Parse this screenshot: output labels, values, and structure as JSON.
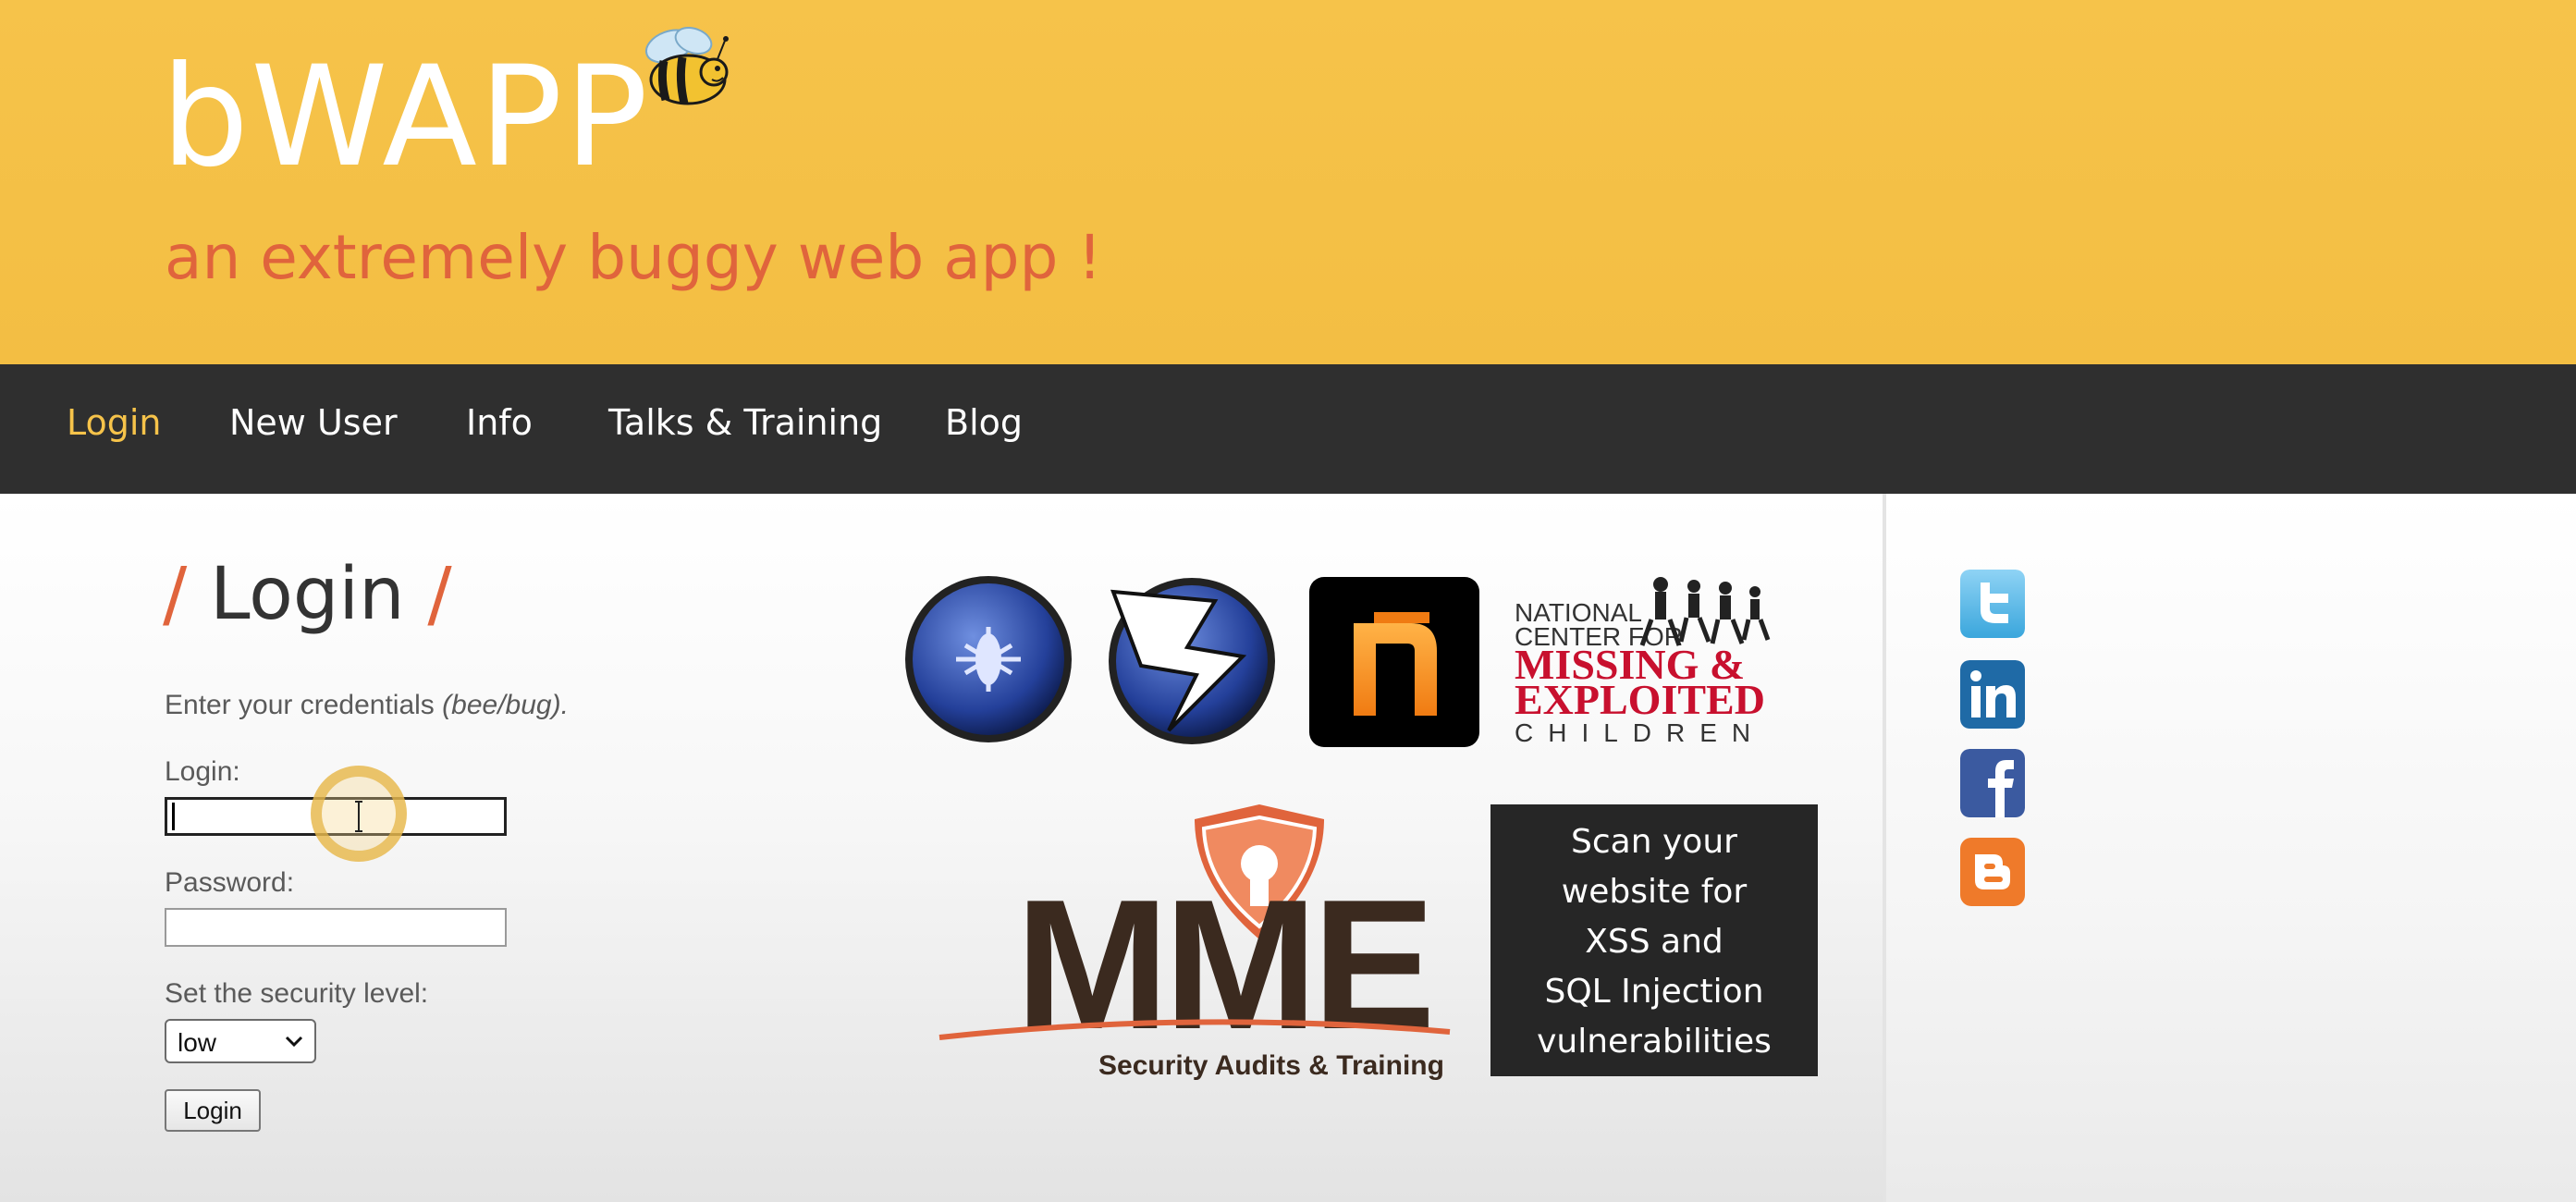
{
  "header": {
    "logo": "bWAPP",
    "tagline": "an extremely buggy web app !"
  },
  "nav": {
    "items": [
      {
        "label": "Login",
        "active": true
      },
      {
        "label": "New User",
        "active": false
      },
      {
        "label": "Info",
        "active": false
      },
      {
        "label": "Talks & Training",
        "active": false
      },
      {
        "label": "Blog",
        "active": false
      }
    ]
  },
  "login": {
    "heading_slash_left": "/",
    "heading": "Login",
    "heading_slash_right": "/",
    "instructions": "Enter your credentials",
    "instructions_hint": "(bee/bug).",
    "login_label": "Login:",
    "login_value": "",
    "password_label": "Password:",
    "password_value": "",
    "security_label": "Set the security level:",
    "security_value": "low",
    "submit_label": "Login"
  },
  "sponsors": {
    "ncmec_line1": "NATIONAL",
    "ncmec_line2": "CENTER FOR",
    "ncmec_line3": "MISSING &",
    "ncmec_line4": "EXPLOITED",
    "ncmec_line5": "CHILDREN",
    "mme_name": "MME",
    "mme_tagline": "Security Audits & Training",
    "scan_ad_lines": [
      "Scan your",
      "website for",
      "XSS and",
      "SQL Injection",
      "vulnerabilities"
    ]
  },
  "social": [
    "twitter-icon",
    "linkedin-icon",
    "facebook-icon",
    "blogger-icon"
  ],
  "colors": {
    "header_bg": "#f6c34a",
    "nav_bg": "#2f2f2f",
    "accent": "#e0643c",
    "nav_active": "#f6c34a"
  }
}
